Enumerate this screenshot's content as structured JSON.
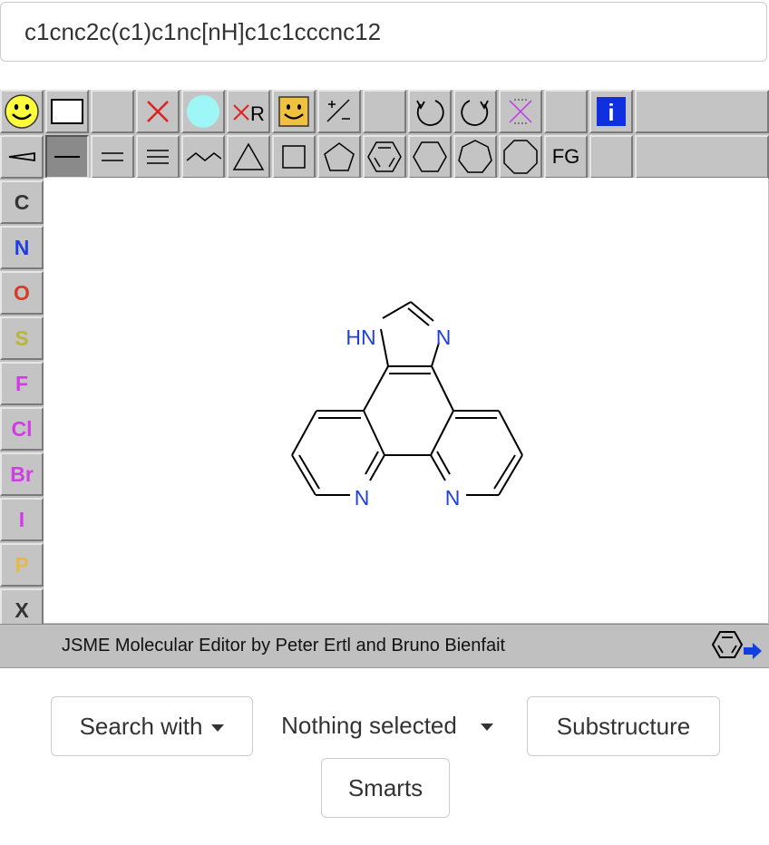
{
  "smiles": {
    "value": "c1cnc2c(c1)c1nc[nH]c1c1cccnc12"
  },
  "editor": {
    "elements": [
      "C",
      "N",
      "O",
      "S",
      "F",
      "Cl",
      "Br",
      "I",
      "P",
      "X"
    ],
    "element_colors": [
      "#333333",
      "#1f3fe0",
      "#d23c28",
      "#b8b43c",
      "#d23ce6",
      "#d23ce6",
      "#d23ce6",
      "#d23ce6",
      "#e6b84a",
      "#333333"
    ],
    "fg_label": "FG",
    "info_label": "i",
    "credit": "JSME Molecular Editor by Peter Ertl and Bruno Bienfait",
    "atom_labels": {
      "hn": "HN",
      "n_imid": "N",
      "n_left": "N",
      "n_right": "N"
    },
    "heteroatom_color": "#1f3fe0"
  },
  "controls": {
    "search_with": "Search with",
    "nothing_selected": "Nothing selected",
    "substructure": "Substructure",
    "smarts": "Smarts"
  }
}
